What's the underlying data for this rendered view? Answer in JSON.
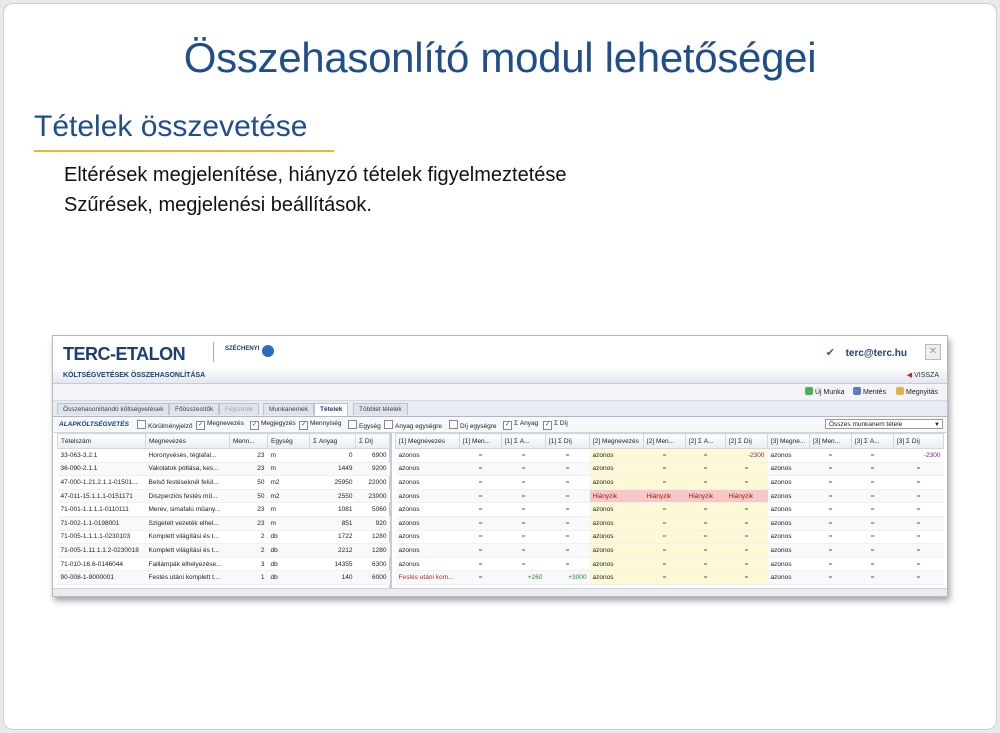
{
  "slide": {
    "title": "Összehasonlító modul lehetőségei",
    "subtitle": "Tételek összevetése",
    "bullets": [
      "Eltérések megjelenítése, hiányzó tételek figyelmeztetése",
      "Szűrések, megjelenési beállítások."
    ]
  },
  "app": {
    "logo": "TERC-ETALON",
    "szechenyi": "SZÉCHENYI",
    "user": "terc@terc.hu",
    "module_title": "KÖLTSÉGVETÉSEK ÖSSZEHASONLÍTÁSA",
    "back_label": "VISSZA",
    "toolbar": {
      "new": "Új Munka",
      "save": "Mentés",
      "open": "Megnyitás"
    },
    "tabs": [
      "Összehasonlítandó költségvetések",
      "Főösszesítők",
      "Fejezetek",
      "Munkanemek",
      "Tételek",
      "Többlet tételek"
    ],
    "filter": {
      "section": "ALAPKÖLTSÉGVETÉS",
      "checks": [
        {
          "label": "Körülményjelző",
          "checked": false
        },
        {
          "label": "Megnevezés",
          "checked": true
        },
        {
          "label": "Megjegyzés",
          "checked": true
        },
        {
          "label": "Mennyiség",
          "checked": true
        },
        {
          "label": "Egység",
          "checked": false
        },
        {
          "label": "Anyag egységre",
          "checked": false
        },
        {
          "label": "Díj egységre",
          "checked": false
        },
        {
          "label": "Σ Anyag",
          "checked": true
        },
        {
          "label": "Σ Díj",
          "checked": true
        }
      ],
      "select_value": "Összes munkanem tétele"
    },
    "left_headers": [
      "Tételszám",
      "Megnevezés",
      "Menn...",
      "Egység",
      "Σ Anyag",
      "Σ Díj"
    ],
    "left_rows": [
      [
        "33-063-3.2.1",
        "Horonyvésés, téglafal...",
        "23",
        "m",
        "0",
        "6900"
      ],
      [
        "36-090-2.1.1",
        "Vakolatok pótlása, kes...",
        "23",
        "m",
        "1449",
        "9200"
      ],
      [
        "47-000-1.21.2.1.1-01501...",
        "Belső festéseknél felül...",
        "50",
        "m2",
        "25950",
        "22000"
      ],
      [
        "47-011-15.1.1.1-0151171",
        "Diszperziós festés mű...",
        "50",
        "m2",
        "2550",
        "23000"
      ],
      [
        "71-001-1.1.1.1-0110111",
        "Merev, simafalú műany...",
        "23",
        "m",
        "1081",
        "5060"
      ],
      [
        "71-002-1.1-0198001",
        "Szigetelt vezeték elhel...",
        "23",
        "m",
        "851",
        "920"
      ],
      [
        "71-005-1.1.1.1-0230103",
        "Komplett világítási és t...",
        "2",
        "db",
        "1722",
        "1280"
      ],
      [
        "71-005-1.11.1.1.2-0230018",
        "Komplett világítási és t...",
        "2",
        "db",
        "2212",
        "1280"
      ],
      [
        "71-010-16.6-0146044",
        "Falilámpák elhelyezése...",
        "3",
        "db",
        "14355",
        "6300"
      ],
      [
        "90-008-1-9000001",
        "Festés utáni komplett t...",
        "1",
        "db",
        "140",
        "6000"
      ]
    ],
    "right_headers": [
      "[1] Megnevezés",
      "[1] Men...",
      "[1] Σ A...",
      "[1] Σ Díj",
      "[2] Megnevezés",
      "[2] Men...",
      "[2] Σ A...",
      "[2] Σ Díj",
      "[3] Megne...",
      "[3] Men...",
      "[3] Σ A...",
      "[3] Σ Díj"
    ],
    "right_rows": [
      [
        "azonos",
        "=",
        "=",
        "=",
        "azonos",
        "=",
        "=",
        "-2300",
        "azonos",
        "=",
        "=",
        "-2300"
      ],
      [
        "azonos",
        "=",
        "=",
        "=",
        "azonos",
        "=",
        "=",
        "=",
        "azonos",
        "=",
        "=",
        "="
      ],
      [
        "azonos",
        "=",
        "=",
        "=",
        "azonos",
        "=",
        "=",
        "=",
        "azonos",
        "=",
        "=",
        "="
      ],
      [
        "azonos",
        "=",
        "=",
        "=",
        "Hiányzik",
        "Hiányzik",
        "Hiányzik",
        "Hiányzik",
        "azonos",
        "=",
        "=",
        "="
      ],
      [
        "azonos",
        "=",
        "=",
        "=",
        "azonos",
        "=",
        "=",
        "=",
        "azonos",
        "=",
        "=",
        "="
      ],
      [
        "azonos",
        "=",
        "=",
        "=",
        "azonos",
        "=",
        "=",
        "=",
        "azonos",
        "=",
        "=",
        "="
      ],
      [
        "azonos",
        "=",
        "=",
        "=",
        "azonos",
        "=",
        "=",
        "=",
        "azonos",
        "=",
        "=",
        "="
      ],
      [
        "azonos",
        "=",
        "=",
        "=",
        "azonos",
        "=",
        "=",
        "=",
        "azonos",
        "=",
        "=",
        "="
      ],
      [
        "azonos",
        "=",
        "=",
        "=",
        "azonos",
        "=",
        "=",
        "=",
        "azonos",
        "=",
        "=",
        "="
      ],
      [
        "Festés utáni kom...",
        "=",
        "+260",
        "+3000",
        "azonos",
        "=",
        "=",
        "=",
        "azonos",
        "=",
        "=",
        "="
      ]
    ],
    "colors": {
      "accent": "#1f4e8a",
      "underline": "#f0b32e",
      "missing": "#f6c9c6",
      "highlight": "#fdf9d7"
    }
  }
}
